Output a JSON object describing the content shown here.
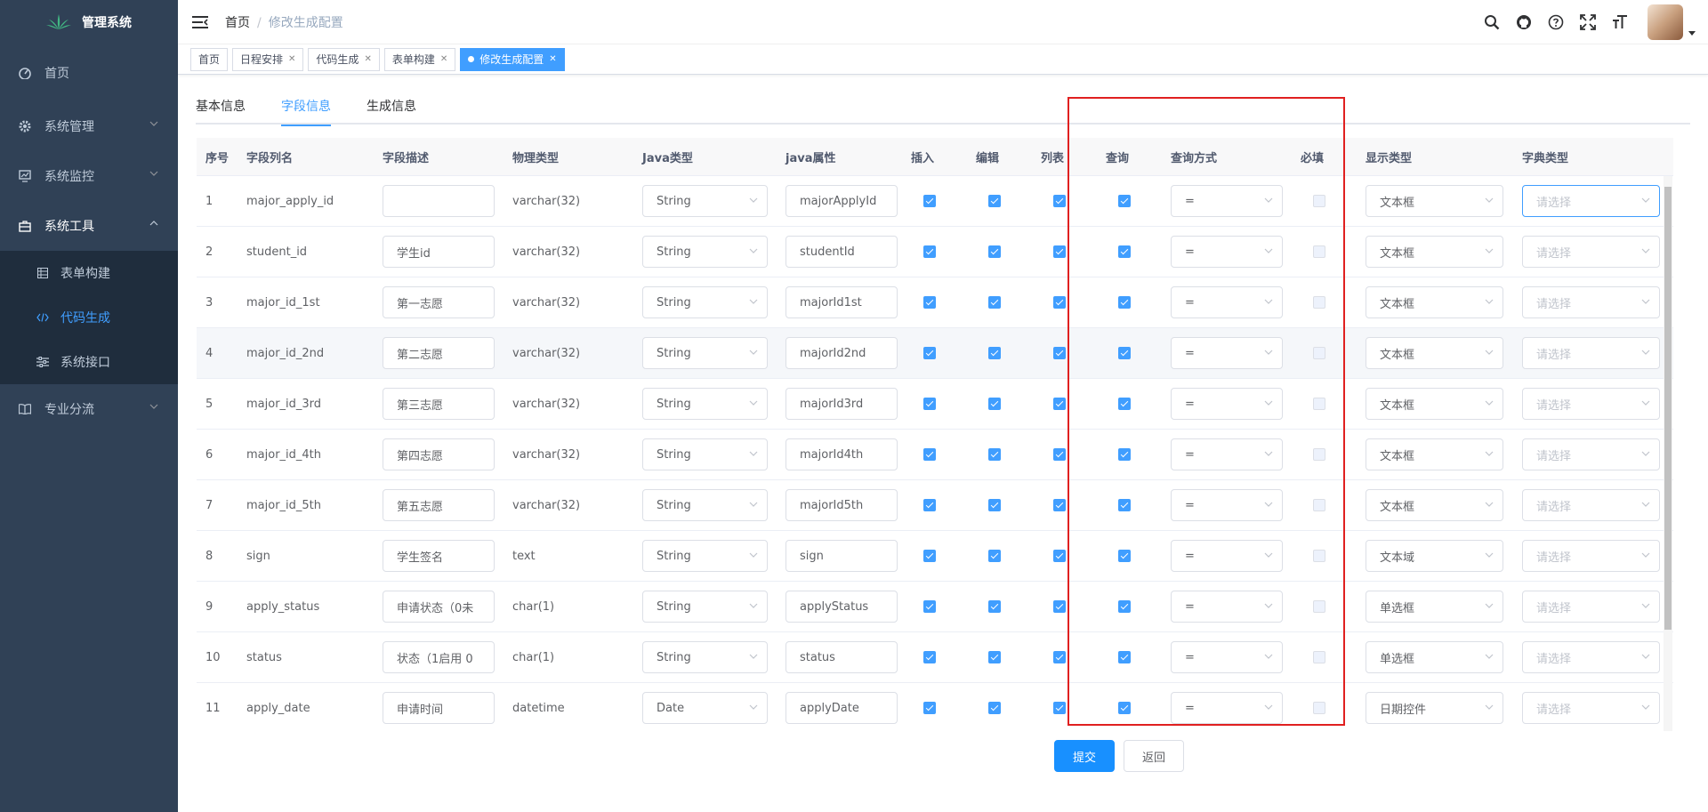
{
  "app": {
    "title": "管理系统"
  },
  "sidebar": {
    "items": [
      {
        "label": "首页",
        "icon": "dashboard-icon"
      },
      {
        "label": "系统管理",
        "icon": "gear-icon"
      },
      {
        "label": "系统监控",
        "icon": "monitor-icon"
      },
      {
        "label": "系统工具",
        "icon": "toolbox-icon"
      },
      {
        "label": "专业分流",
        "icon": "book-icon"
      }
    ],
    "sub_items": [
      {
        "label": "表单构建",
        "icon": "form-grid-icon"
      },
      {
        "label": "代码生成",
        "icon": "code-icon"
      },
      {
        "label": "系统接口",
        "icon": "sliders-icon"
      }
    ]
  },
  "breadcrumb": {
    "home": "首页",
    "sep": "/",
    "current": "修改生成配置"
  },
  "tags": [
    "首页",
    "日程安排",
    "代码生成",
    "表单构建",
    "修改生成配置"
  ],
  "tabs": [
    "基本信息",
    "字段信息",
    "生成信息"
  ],
  "table": {
    "headers": [
      "序号",
      "字段列名",
      "字段描述",
      "物理类型",
      "Java类型",
      "java属性",
      "插入",
      "编辑",
      "列表",
      "查询",
      "查询方式",
      "必填",
      "显示类型",
      "字典类型"
    ],
    "dict_placeholder": "请选择",
    "rows": [
      {
        "no": "1",
        "col": "major_apply_id",
        "desc": "",
        "ptype": "varchar(32)",
        "jtype": "String",
        "attr": "majorApplyId",
        "qtype": "=",
        "show": "文本框"
      },
      {
        "no": "2",
        "col": "student_id",
        "desc": "学生id",
        "ptype": "varchar(32)",
        "jtype": "String",
        "attr": "studentId",
        "qtype": "=",
        "show": "文本框"
      },
      {
        "no": "3",
        "col": "major_id_1st",
        "desc": "第一志愿",
        "ptype": "varchar(32)",
        "jtype": "String",
        "attr": "majorId1st",
        "qtype": "=",
        "show": "文本框"
      },
      {
        "no": "4",
        "col": "major_id_2nd",
        "desc": "第二志愿",
        "ptype": "varchar(32)",
        "jtype": "String",
        "attr": "majorId2nd",
        "qtype": "=",
        "show": "文本框"
      },
      {
        "no": "5",
        "col": "major_id_3rd",
        "desc": "第三志愿",
        "ptype": "varchar(32)",
        "jtype": "String",
        "attr": "majorId3rd",
        "qtype": "=",
        "show": "文本框"
      },
      {
        "no": "6",
        "col": "major_id_4th",
        "desc": "第四志愿",
        "ptype": "varchar(32)",
        "jtype": "String",
        "attr": "majorId4th",
        "qtype": "=",
        "show": "文本框"
      },
      {
        "no": "7",
        "col": "major_id_5th",
        "desc": "第五志愿",
        "ptype": "varchar(32)",
        "jtype": "String",
        "attr": "majorId5th",
        "qtype": "=",
        "show": "文本框"
      },
      {
        "no": "8",
        "col": "sign",
        "desc": "学生签名",
        "ptype": "text",
        "jtype": "String",
        "attr": "sign",
        "qtype": "=",
        "show": "文本域"
      },
      {
        "no": "9",
        "col": "apply_status",
        "desc": "申请状态（0未",
        "ptype": "char(1)",
        "jtype": "String",
        "attr": "applyStatus",
        "qtype": "=",
        "show": "单选框"
      },
      {
        "no": "10",
        "col": "status",
        "desc": "状态（1启用 0",
        "ptype": "char(1)",
        "jtype": "String",
        "attr": "status",
        "qtype": "=",
        "show": "单选框"
      },
      {
        "no": "11",
        "col": "apply_date",
        "desc": "申请时间",
        "ptype": "datetime",
        "jtype": "Date",
        "attr": "applyDate",
        "qtype": "=",
        "show": "日期控件"
      }
    ]
  },
  "buttons": {
    "submit": "提交",
    "back": "返回"
  },
  "colors": {
    "sidebar": "#304156",
    "accent": "#409eff",
    "highlight_box": "#e02020"
  }
}
